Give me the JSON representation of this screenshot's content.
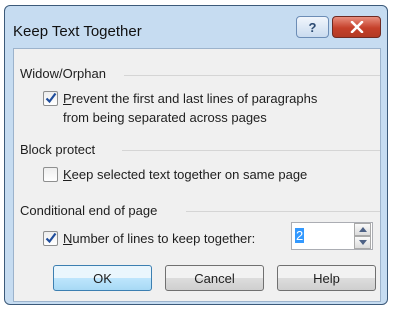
{
  "window": {
    "title": "Keep Text Together"
  },
  "titlebar": {
    "help_label": "?"
  },
  "groups": {
    "widow_orphan": {
      "label": "Widow/Orphan",
      "option": {
        "line1_mnemonic": "P",
        "line1_rest": "revent the first and last lines of paragraphs",
        "line2": "from being separated across pages",
        "checked": true
      }
    },
    "block_protect": {
      "label": "Block protect",
      "option": {
        "mnemonic": "K",
        "rest": "eep selected text together on same page",
        "checked": false
      }
    },
    "conditional": {
      "label": "Conditional end of page",
      "option": {
        "mnemonic": "N",
        "rest": "umber of lines to keep together:",
        "checked": true
      },
      "spinner_value": "2"
    }
  },
  "buttons": {
    "ok": "OK",
    "cancel": "Cancel",
    "help": "Help"
  },
  "colors": {
    "frame": "#c6dcf1",
    "close": "#c5402a",
    "checkmark": "#1f4d9c",
    "selection": "#3399ff"
  }
}
